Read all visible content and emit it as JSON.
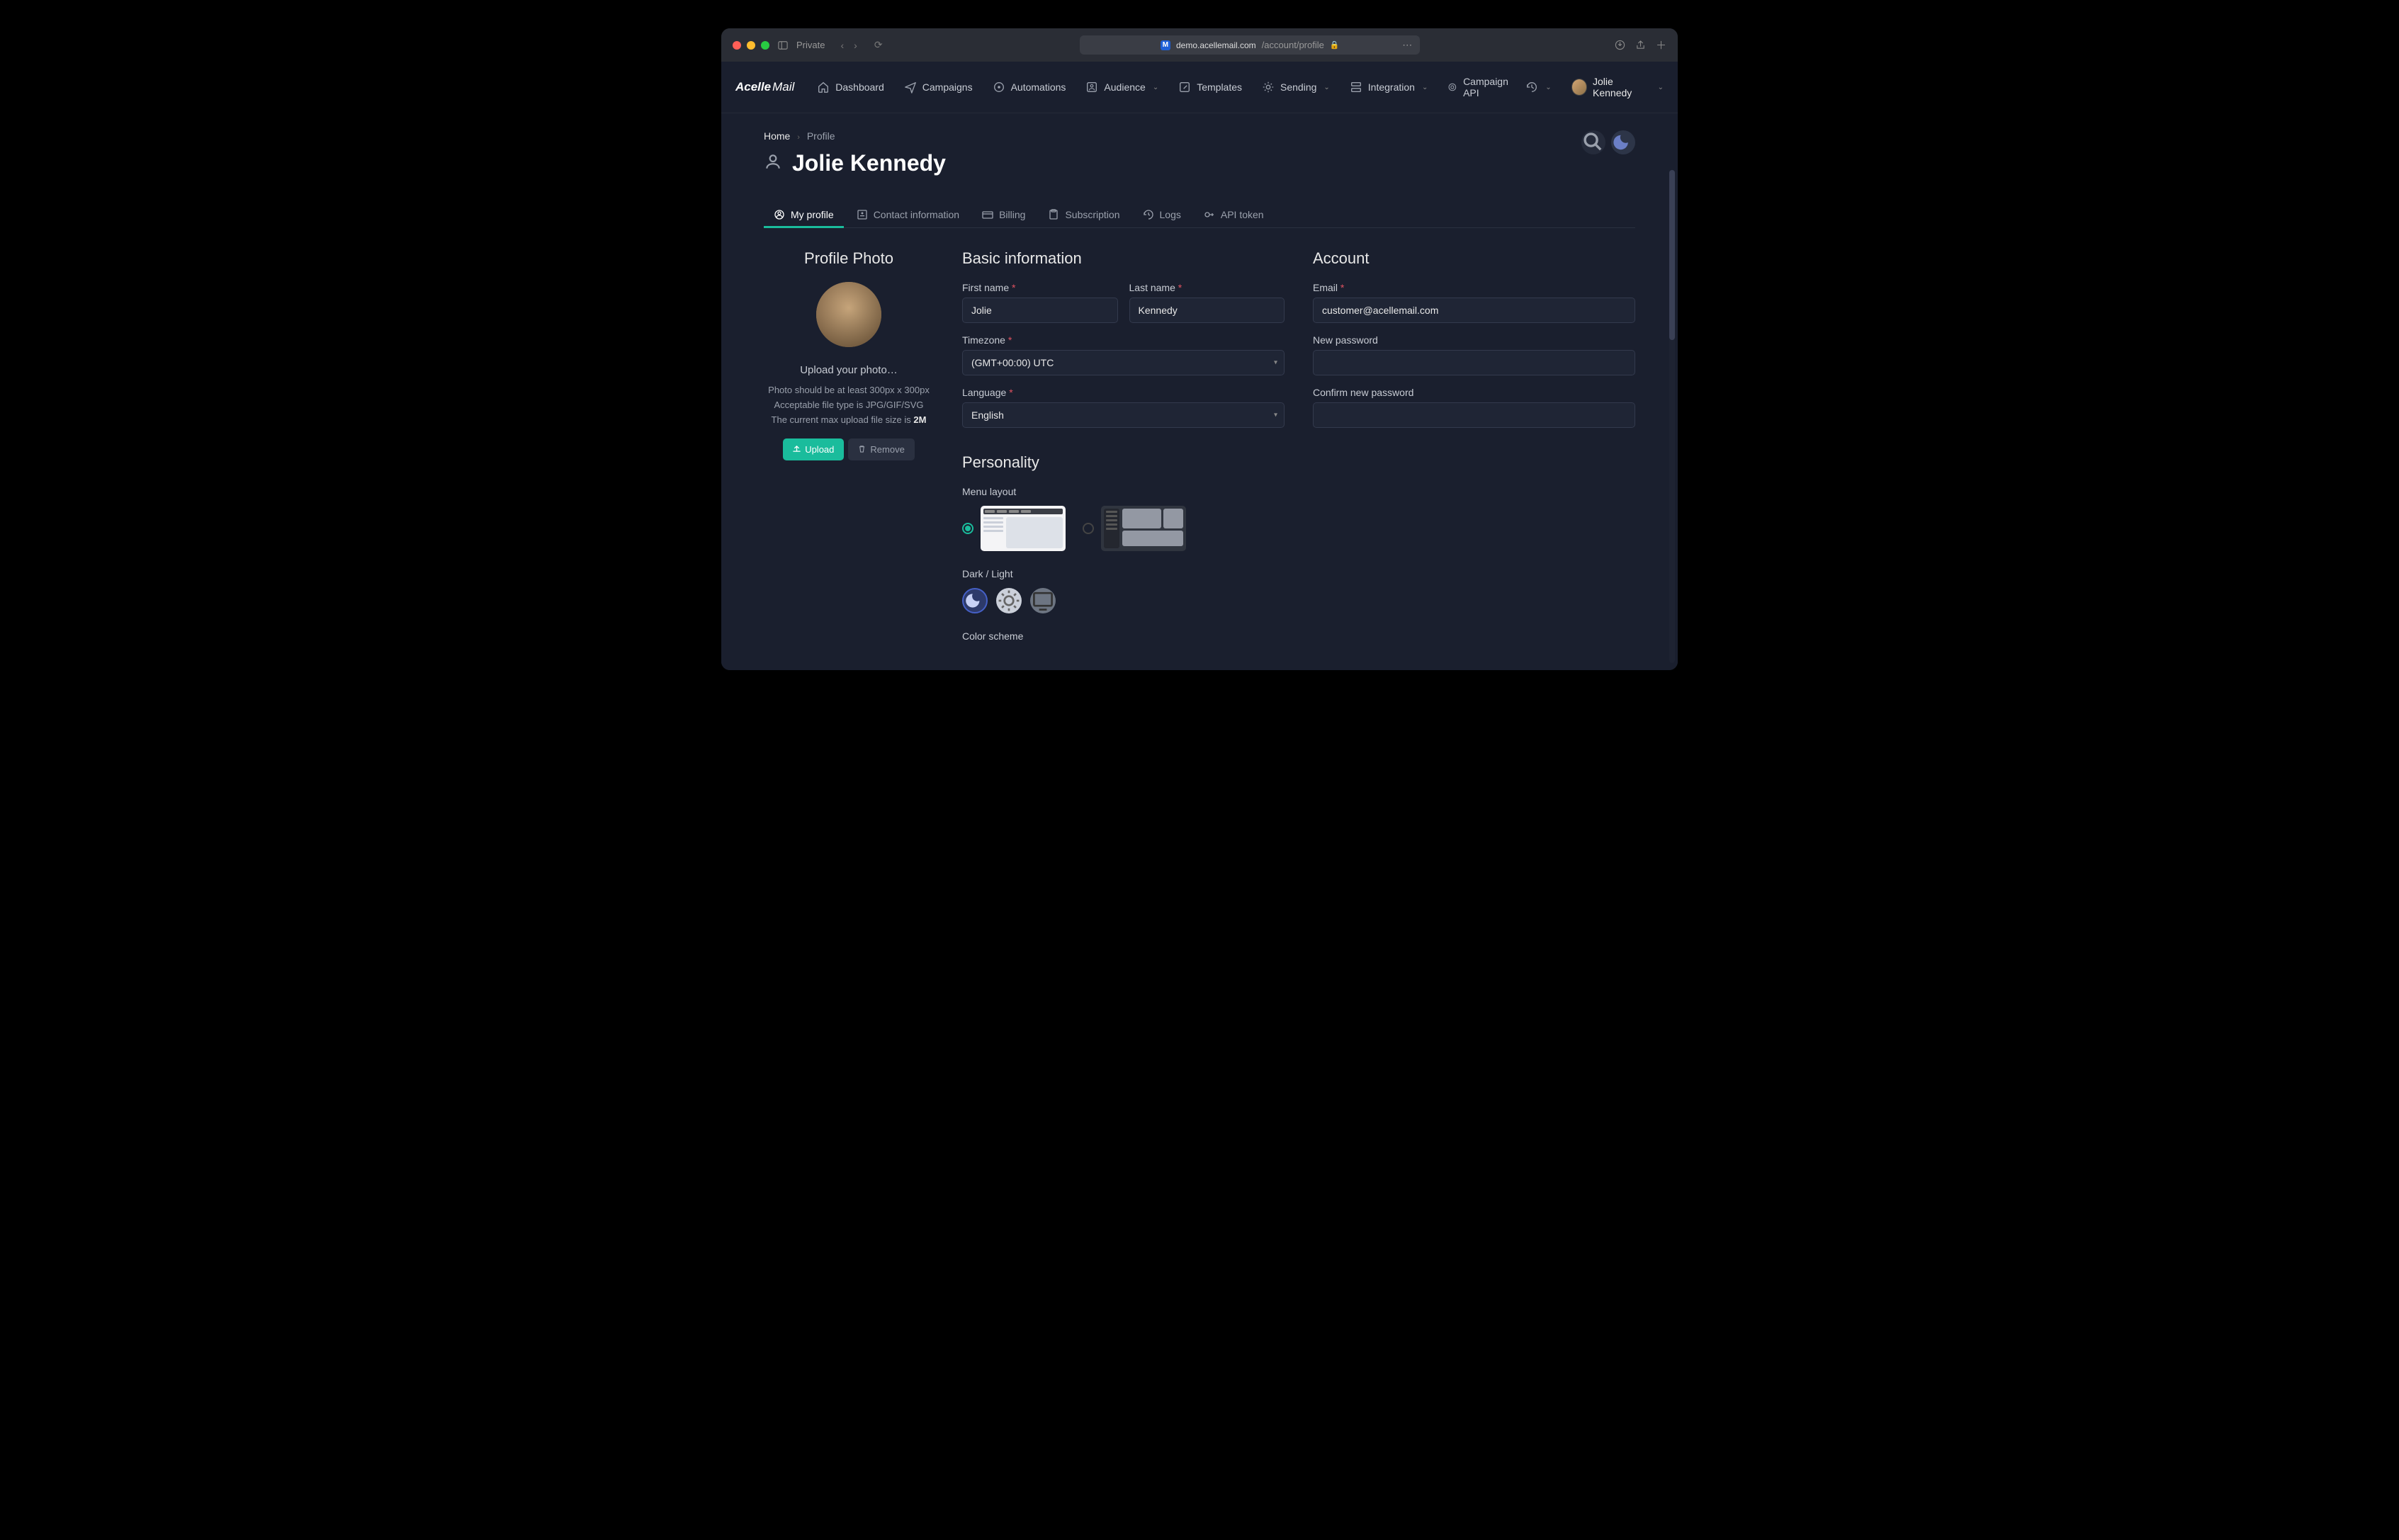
{
  "browser": {
    "private_label": "Private",
    "url_host": "demo.acellemail.com",
    "url_path": "/account/profile"
  },
  "brand": {
    "name": "Acelle",
    "suffix": "Mail"
  },
  "nav": {
    "dashboard": "Dashboard",
    "campaigns": "Campaigns",
    "automations": "Automations",
    "audience": "Audience",
    "templates": "Templates",
    "sending": "Sending",
    "integration": "Integration",
    "campaign_api": "Campaign API"
  },
  "user": {
    "display_name": "Jolie Kennedy"
  },
  "breadcrumb": {
    "home": "Home",
    "current": "Profile"
  },
  "page_title": "Jolie Kennedy",
  "tabs": {
    "my_profile": "My profile",
    "contact_info": "Contact information",
    "billing": "Billing",
    "subscription": "Subscription",
    "logs": "Logs",
    "api_token": "API token"
  },
  "photo": {
    "section_title": "Profile Photo",
    "upload_label": "Upload your photo…",
    "help_line1": "Photo should be at least 300px x 300px",
    "help_line2": "Acceptable file type is JPG/GIF/SVG",
    "help_line3": "The current max upload file size is ",
    "help_size": "2M",
    "btn_upload": "Upload",
    "btn_remove": "Remove"
  },
  "basic": {
    "section_title": "Basic information",
    "first_name_label": "First name",
    "first_name_value": "Jolie",
    "last_name_label": "Last name",
    "last_name_value": "Kennedy",
    "timezone_label": "Timezone",
    "timezone_value": "(GMT+00:00) UTC",
    "language_label": "Language",
    "language_value": "English"
  },
  "account": {
    "section_title": "Account",
    "email_label": "Email",
    "email_value": "customer@acellemail.com",
    "new_password_label": "New password",
    "confirm_password_label": "Confirm new password"
  },
  "personality": {
    "section_title": "Personality",
    "menu_layout_label": "Menu layout",
    "dark_light_label": "Dark / Light",
    "color_scheme_label": "Color scheme"
  }
}
